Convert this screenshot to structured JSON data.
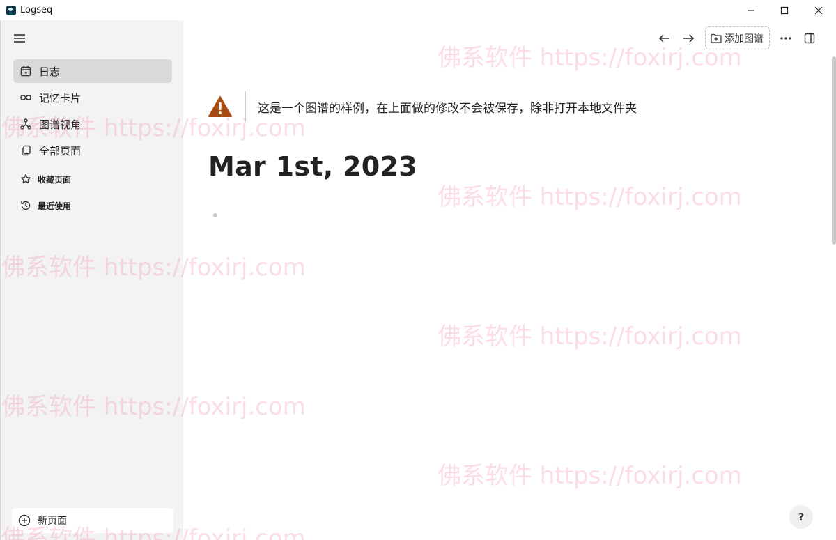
{
  "window": {
    "title": "Logseq"
  },
  "sidebar": {
    "items": [
      {
        "label": "日志",
        "icon": "calendar-icon",
        "active": true
      },
      {
        "label": "记忆卡片",
        "icon": "infinity-icon"
      },
      {
        "label": "图谱视角",
        "icon": "graph-icon"
      },
      {
        "label": "全部页面",
        "icon": "pages-icon"
      },
      {
        "label": "收藏页面",
        "icon": "star-icon"
      },
      {
        "label": "最近使用",
        "icon": "history-icon"
      }
    ],
    "new_page_label": "新页面"
  },
  "toolbar": {
    "add_graph_label": "添加图谱"
  },
  "notice": {
    "text": "这是一个图谱的样例，在上面做的修改不会被保存，除非打开本地文件夹"
  },
  "journal": {
    "title": "Mar 1st, 2023"
  },
  "help": {
    "label": "?"
  },
  "watermark": {
    "text": "佛系软件 https://foxirj.com"
  },
  "colors": {
    "warning": "#a64b12",
    "active_bg": "#d9d9d9",
    "sidebar_bg": "#f3f3f3"
  }
}
